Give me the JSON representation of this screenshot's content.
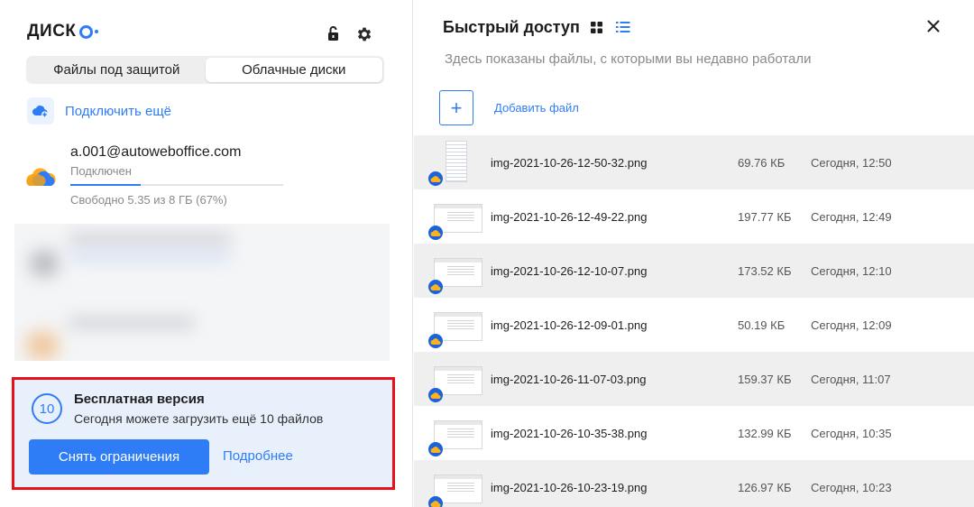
{
  "app": {
    "logo": "ДИСК"
  },
  "segment": {
    "tabs": [
      "Файлы под защитой",
      "Облачные диски"
    ],
    "active": 1
  },
  "connect": {
    "label": "Подключить ещё"
  },
  "account": {
    "email": "a.001@autoweboffice.com",
    "status": "Подключен",
    "free": "Свободно 5.35 из 8 ГБ (67%)",
    "used_fraction": 0.33
  },
  "promo": {
    "badge": "10",
    "title": "Бесплатная версия",
    "subtitle": "Сегодня можете загрузить ещё 10 файлов",
    "button": "Снять ограничения",
    "more": "Подробнее"
  },
  "quick": {
    "title": "Быстрый доступ",
    "subtitle": "Здесь показаны файлы, с которыми вы недавно работали",
    "add_label": "Добавить файл",
    "add_icon": "+"
  },
  "files": [
    {
      "name": "img-2021-10-26-12-50-32.png",
      "size": "69.76 КБ",
      "date": "Сегодня, 12:50",
      "thumb": "tall"
    },
    {
      "name": "img-2021-10-26-12-49-22.png",
      "size": "197.77 КБ",
      "date": "Сегодня, 12:49",
      "thumb": "wide"
    },
    {
      "name": "img-2021-10-26-12-10-07.png",
      "size": "173.52 КБ",
      "date": "Сегодня, 12:10",
      "thumb": "wide"
    },
    {
      "name": "img-2021-10-26-12-09-01.png",
      "size": "50.19 КБ",
      "date": "Сегодня, 12:09",
      "thumb": "wide"
    },
    {
      "name": "img-2021-10-26-11-07-03.png",
      "size": "159.37 КБ",
      "date": "Сегодня, 11:07",
      "thumb": "wide"
    },
    {
      "name": "img-2021-10-26-10-35-38.png",
      "size": "132.99 КБ",
      "date": "Сегодня, 10:35",
      "thumb": "wide"
    },
    {
      "name": "img-2021-10-26-10-23-19.png",
      "size": "126.97 КБ",
      "date": "Сегодня, 10:23",
      "thumb": "wide"
    }
  ],
  "colors": {
    "accent": "#2f7df6",
    "highlight_border": "#e8111b",
    "promo_bg": "#e8f0fb"
  },
  "icons": {
    "lock": "unlock-icon",
    "settings": "gear-icon",
    "grid_view": "grid-icon",
    "list_view": "list-icon",
    "close": "close-icon",
    "cloud_add": "cloud-add-icon",
    "account_avatar": "cloud-avatar-icon"
  }
}
